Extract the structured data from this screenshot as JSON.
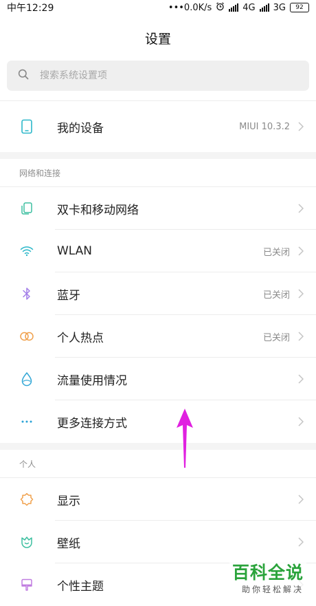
{
  "status_bar": {
    "time": "中午12:29",
    "network_speed": "•••0.0K/s",
    "alarm_icon": "alarm-clock-icon",
    "net1": "4G",
    "net2": "3G",
    "battery": "92"
  },
  "header": {
    "title": "设置"
  },
  "search": {
    "placeholder": "搜索系统设置项",
    "icon": "search-icon"
  },
  "device": {
    "label": "我的设备",
    "value": "MIUI 10.3.2",
    "icon": "phone-icon"
  },
  "network_section": {
    "header": "网络和连接",
    "items": [
      {
        "label": "双卡和移动网络",
        "value": "",
        "icon": "sim-cards-icon",
        "color": "#3dbfa0"
      },
      {
        "label": "WLAN",
        "value": "已关闭",
        "icon": "wifi-icon",
        "color": "#2bb7c9"
      },
      {
        "label": "蓝牙",
        "value": "已关闭",
        "icon": "bluetooth-icon",
        "color": "#a27de8"
      },
      {
        "label": "个人热点",
        "value": "已关闭",
        "icon": "hotspot-icon",
        "color": "#f0a04b"
      },
      {
        "label": "流量使用情况",
        "value": "",
        "icon": "data-drop-icon",
        "color": "#33a7d6"
      },
      {
        "label": "更多连接方式",
        "value": "",
        "icon": "more-dots-icon",
        "color": "#2ba3d6"
      }
    ]
  },
  "personal_section": {
    "header": "个人",
    "items": [
      {
        "label": "显示",
        "value": "",
        "icon": "brightness-icon",
        "color": "#f0a04b"
      },
      {
        "label": "壁纸",
        "value": "",
        "icon": "wallpaper-tulip-icon",
        "color": "#3dbfa0"
      },
      {
        "label": "个性主题",
        "value": "",
        "icon": "theme-brush-icon",
        "color": "#c07ce0"
      }
    ]
  },
  "watermark": {
    "main": "百科全说",
    "sub": "助你轻松解决"
  },
  "colors": {
    "arrow": "#e020e0",
    "chevron": "#c4c4c4",
    "section_bg": "#f4f4f4",
    "device_icon": "#2bb7c9"
  }
}
